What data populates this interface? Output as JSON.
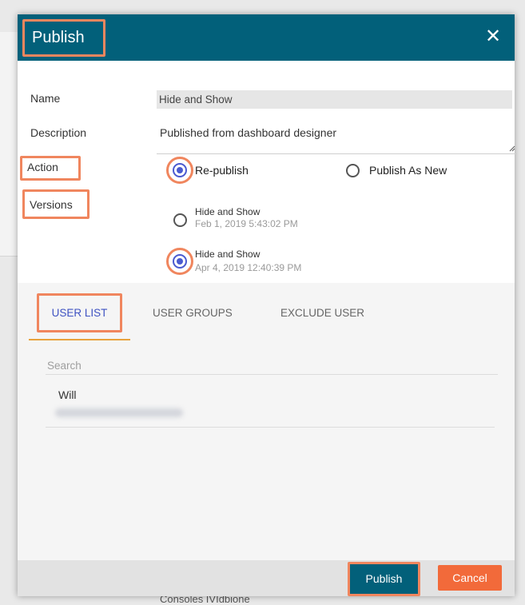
{
  "background": {
    "bottom_text": "Consoles IVIdbione"
  },
  "dialog": {
    "title": "Publish",
    "close_label": "✕",
    "labels": {
      "name": "Name",
      "description": "Description",
      "action": "Action",
      "versions": "Versions"
    },
    "name_value": "Hide and Show",
    "description_value": "Published from dashboard designer",
    "action_options": [
      {
        "label": "Re-publish",
        "selected": true
      },
      {
        "label": "Publish As New",
        "selected": false
      }
    ],
    "versions": [
      {
        "name": "Hide and Show",
        "date": "Feb 1, 2019 5:43:02 PM",
        "selected": false
      },
      {
        "name": "Hide and Show",
        "date": "Apr 4, 2019 12:40:39 PM",
        "selected": true
      }
    ],
    "tabs": [
      {
        "label": "USER LIST",
        "active": true
      },
      {
        "label": "USER GROUPS",
        "active": false
      },
      {
        "label": "EXCLUDE USER",
        "active": false
      }
    ],
    "search_placeholder": "Search",
    "users": [
      {
        "name": "Will"
      }
    ],
    "buttons": {
      "publish": "Publish",
      "cancel": "Cancel"
    }
  },
  "colors": {
    "header": "#02607a",
    "highlight": "#f0865e",
    "radio_selected": "#4a5ad0",
    "tab_active": "#3e52c2",
    "tab_underline": "#e8a33d",
    "cancel": "#f26a3a"
  },
  "icons": {
    "close": "close-icon",
    "resize": "resize-handle-icon"
  }
}
